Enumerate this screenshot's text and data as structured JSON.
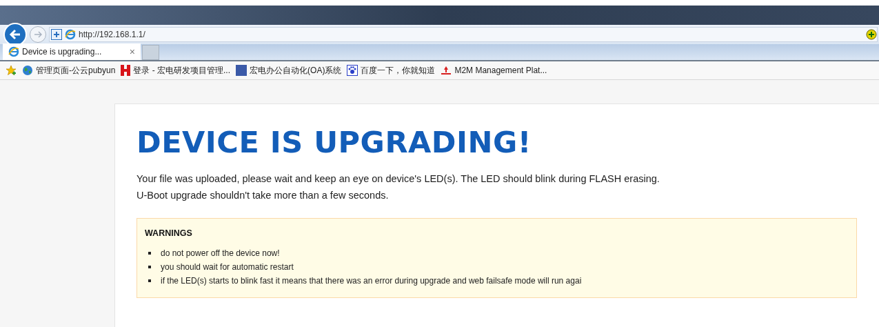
{
  "browser": {
    "address": "http://192.168.1.1/",
    "tab": {
      "title": "Device is upgrading...",
      "close": "×"
    },
    "favorites": [
      {
        "label": "管理页面-公云pubyun",
        "kind": "globe"
      },
      {
        "label": "登录 - 宏电研发项目管理...",
        "kind": "red"
      },
      {
        "label": "宏电办公自动化(OA)系统",
        "kind": "td"
      },
      {
        "label": "百度一下，你就知道",
        "kind": "paw"
      },
      {
        "label": "M2M Management Plat...",
        "kind": "upload"
      }
    ]
  },
  "page": {
    "title": "DEVICE IS UPGRADING!",
    "paragraphs": [
      "Your file was uploaded, please wait and keep an eye on device's LED(s). The LED should blink during FLASH erasing.",
      "U-Boot upgrade shouldn't take more than a few seconds."
    ],
    "warnings": {
      "title": "WARNINGS",
      "items": [
        "do not power off the device now!",
        "you should wait for automatic restart",
        "if the LED(s) starts to blink fast it means that there was an error during upgrade and web failsafe mode will run agai"
      ]
    }
  }
}
